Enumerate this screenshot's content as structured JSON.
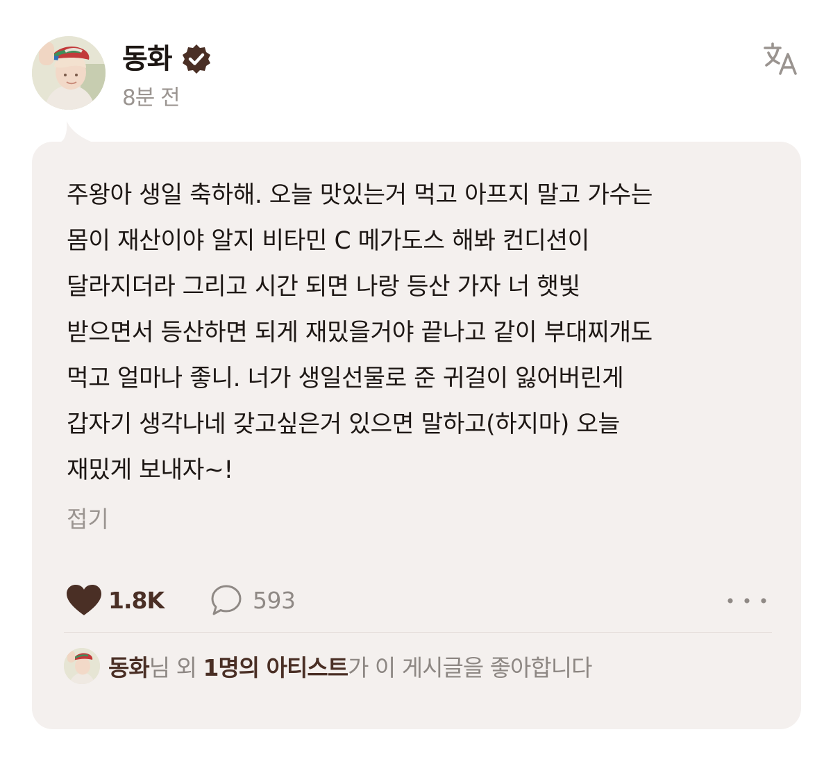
{
  "post": {
    "author": "동화",
    "time": "8분 전",
    "body_lines": [
      "주왕아 생일 축하해. 오늘 맛있는거 먹고 아프지 말고 가수는",
      "몸이 재산이야 알지 비타민 C 메가도스 해봐 컨디션이",
      "달라지더라 그리고 시간 되면 나랑 등산 가자 너 햇빛",
      "받으면서 등산하면 되게 재밌을거야 끝나고 같이 부대찌개도",
      "먹고 얼마나 좋니. 너가 생일선물로 준 귀걸이 잃어버린게",
      "갑자기 생각나네 갖고싶은거 있으면 말하고(하지마) 오늘",
      "재밌게 보내자~!"
    ],
    "collapse_label": "접기"
  },
  "actions": {
    "like_count": "1.8K",
    "comment_count": "593"
  },
  "liked_by": {
    "name": "동화",
    "suffix1": "님 외 ",
    "artists": "1명의 아티스트",
    "suffix2": "가 이 게시글을 좋아합니다"
  },
  "icons": {
    "verified": "verified-badge-icon",
    "translate": "translate-icon",
    "like": "heart-icon",
    "comment": "comment-bubble-icon",
    "more": "more-dots-icon"
  },
  "colors": {
    "bubble_background": "#f4f0ee",
    "accent_brown": "#4a2f25",
    "muted_text": "#9b9591"
  }
}
